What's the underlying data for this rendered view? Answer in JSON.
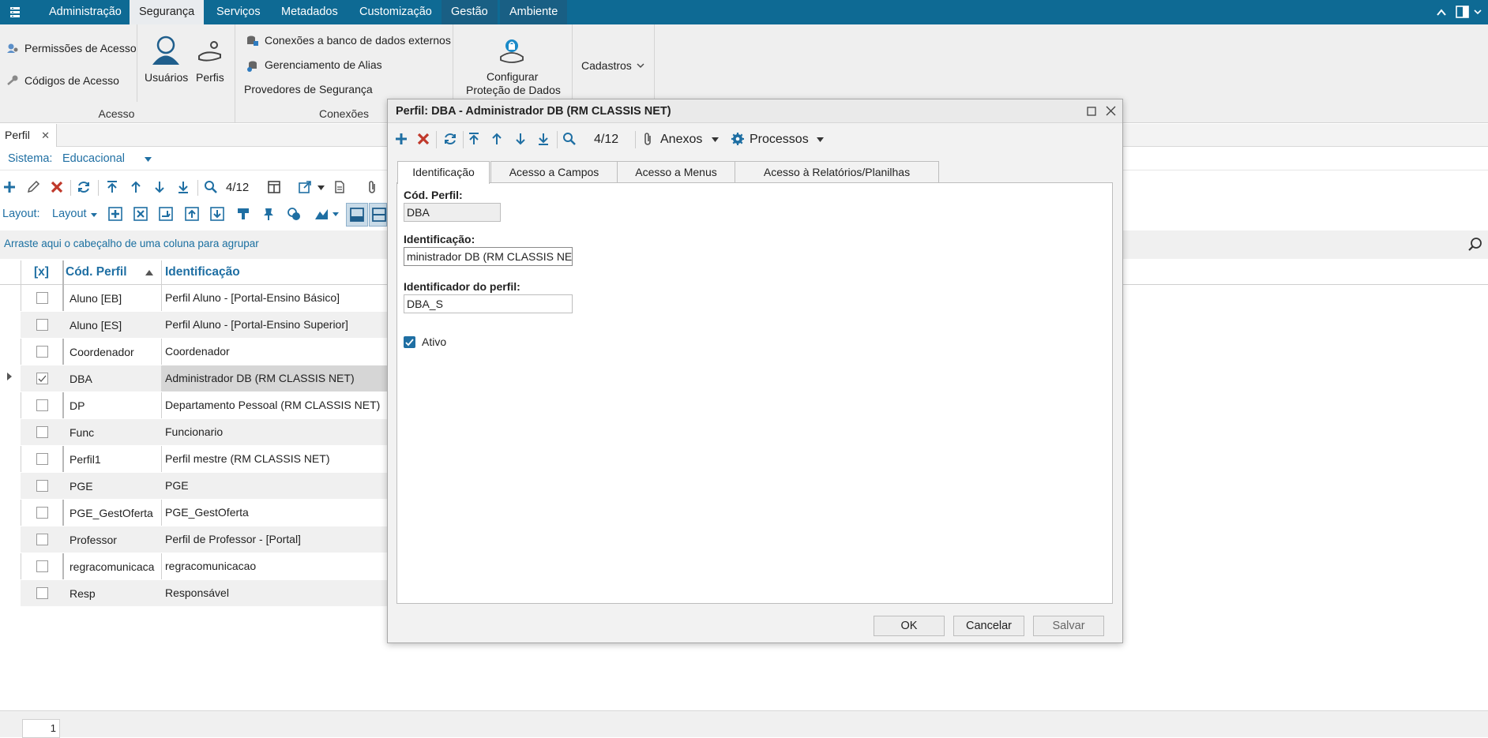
{
  "menu": {
    "items": [
      "Administração",
      "Segurança",
      "Serviços",
      "Metadados",
      "Customização",
      "Gestão",
      "Ambiente"
    ]
  },
  "ribbon": {
    "acesso": {
      "permissoes": "Permissões de Acesso",
      "codigos": "Códigos de Acesso",
      "usuarios": "Usuários",
      "perfis": "Perfis",
      "group_label": "Acesso"
    },
    "conexoes": {
      "externos": "Conexões a banco de dados externos",
      "alias": "Gerenciamento de Alias",
      "provedores": "Provedores de Segurança",
      "group_label": "Conexões"
    },
    "protecao": {
      "line1": "Configurar",
      "line2": "Proteção de Dados"
    },
    "cadastros": "Cadastros"
  },
  "doc_tab": {
    "label": "Perfil"
  },
  "sistema": {
    "label": "Sistema:",
    "value": "Educacional"
  },
  "toolbar": {
    "record_counter": "4/12"
  },
  "layout_toolbar": {
    "label": "Layout:",
    "dropdown": "Layout"
  },
  "groupby": {
    "hint": "Arraste aqui o cabeçalho de uma coluna para agrupar"
  },
  "grid": {
    "columns": {
      "check": "[x]",
      "cod": "Cód. Perfil",
      "ident": "Identificação"
    },
    "rows": [
      {
        "cod": "Aluno [EB]",
        "ident": "Perfil Aluno - [Portal-Ensino Básico]"
      },
      {
        "cod": "Aluno [ES]",
        "ident": "Perfil Aluno - [Portal-Ensino Superior]"
      },
      {
        "cod": "Coordenador",
        "ident": "Coordenador"
      },
      {
        "cod": "DBA",
        "ident": "Administrador DB (RM CLASSIS NET)"
      },
      {
        "cod": "DP",
        "ident": "Departamento Pessoal (RM CLASSIS NET)"
      },
      {
        "cod": "Func",
        "ident": "Funcionario"
      },
      {
        "cod": "Perfil1",
        "ident": "Perfil mestre (RM CLASSIS NET)"
      },
      {
        "cod": "PGE",
        "ident": "PGE"
      },
      {
        "cod": "PGE_GestOferta",
        "ident": "PGE_GestOferta"
      },
      {
        "cod": "Professor",
        "ident": "Perfil de Professor - [Portal]"
      },
      {
        "cod": "regracomunicaca",
        "ident": "regracomunicacao"
      },
      {
        "cod": "Resp",
        "ident": "Responsável"
      }
    ],
    "selected_index": 3
  },
  "footer": {
    "page": "1"
  },
  "dialog": {
    "title": "Perfil: DBA - Administrador DB (RM CLASSIS NET)",
    "counter": "4/12",
    "anexos": "Anexos",
    "processos": "Processos",
    "tabs": [
      "Identificação",
      "Acesso a Campos",
      "Acesso a Menus",
      "Acesso à Relatórios/Planilhas"
    ],
    "fields": {
      "cod_label": "Cód. Perfil:",
      "cod_value": "DBA",
      "ident_label": "Identificação:",
      "ident_value": "ministrador DB (RM CLASSIS NET)",
      "idperfil_label": "Identificador do perfil:",
      "idperfil_value": "DBA_S",
      "ativo_label": "Ativo"
    },
    "buttons": {
      "ok": "OK",
      "cancel": "Cancelar",
      "save": "Salvar"
    }
  },
  "colors": {
    "brand": "#0e6a94",
    "accent": "#1f6fa3",
    "delete": "#c0392b"
  }
}
